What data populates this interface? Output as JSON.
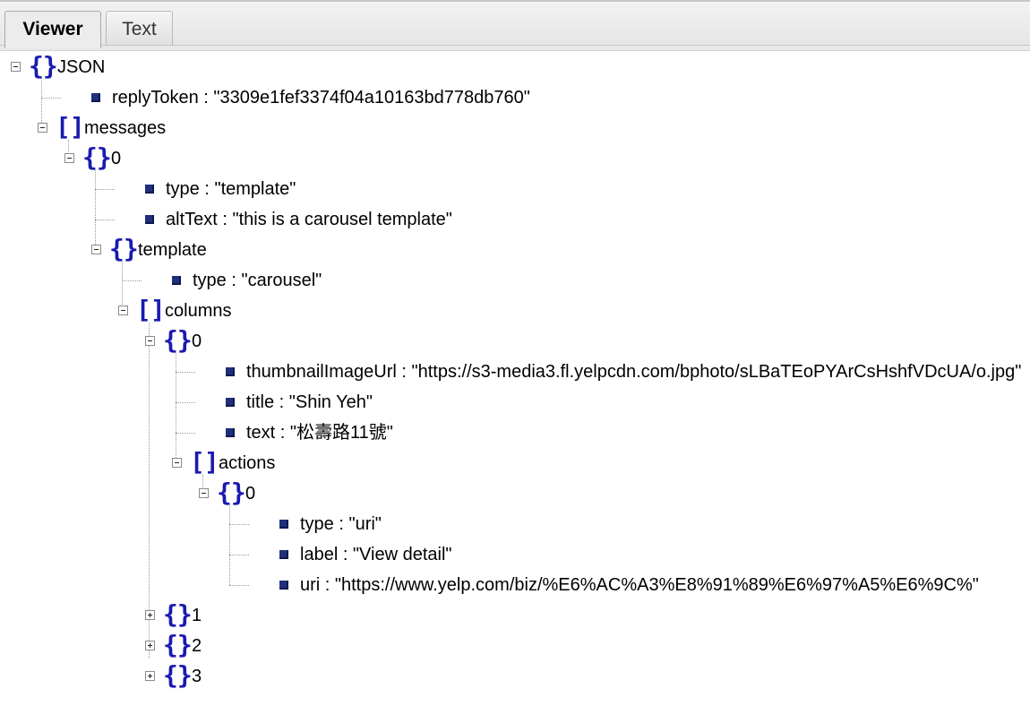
{
  "tabs": [
    {
      "label": "Viewer",
      "active": true
    },
    {
      "label": "Text",
      "active": false
    }
  ],
  "nodes": [
    {
      "text": "JSON",
      "kind": "object",
      "expanded": true
    },
    {
      "text": "replyToken : \"3309e1fef3374f04a10163bd778db760\"",
      "kind": "leaf"
    },
    {
      "text": "messages",
      "kind": "array",
      "expanded": true
    },
    {
      "text": "0",
      "kind": "object",
      "expanded": true
    },
    {
      "text": "type : \"template\"",
      "kind": "leaf"
    },
    {
      "text": "altText : \"this is a carousel template\"",
      "kind": "leaf"
    },
    {
      "text": "template",
      "kind": "object",
      "expanded": true
    },
    {
      "text": "type : \"carousel\"",
      "kind": "leaf"
    },
    {
      "text": "columns",
      "kind": "array",
      "expanded": true
    },
    {
      "text": "0",
      "kind": "object",
      "expanded": true
    },
    {
      "text": "thumbnailImageUrl : \"https://s3-media3.fl.yelpcdn.com/bphoto/sLBaTEoPYArCsHshfVDcUA/o.jpg\"",
      "kind": "leaf"
    },
    {
      "text": "title : \"Shin Yeh\"",
      "kind": "leaf"
    },
    {
      "text": "text : \"松壽路11號\"",
      "kind": "leaf"
    },
    {
      "text": "actions",
      "kind": "array",
      "expanded": true
    },
    {
      "text": "0",
      "kind": "object",
      "expanded": true
    },
    {
      "text": "type : \"uri\"",
      "kind": "leaf"
    },
    {
      "text": "label : \"View detail\"",
      "kind": "leaf"
    },
    {
      "text": "uri : \"https://www.yelp.com/biz/%E6%AC%A3%E8%91%89%E6%97%A5%E6%9C%\"",
      "kind": "leaf"
    },
    {
      "text": "1",
      "kind": "object",
      "expanded": false
    },
    {
      "text": "2",
      "kind": "object",
      "expanded": false
    },
    {
      "text": "3",
      "kind": "object",
      "expanded": false
    }
  ],
  "colors": {
    "bracket": "#1a1ab0",
    "leaf_marker": "#1f2f7a",
    "connector": "#9a9a9a"
  },
  "icons": {
    "expanded": "minus-box-icon",
    "collapsed": "plus-box-icon",
    "object": "curly-braces-icon",
    "array": "square-brackets-icon",
    "leaf": "blue-square-icon"
  }
}
